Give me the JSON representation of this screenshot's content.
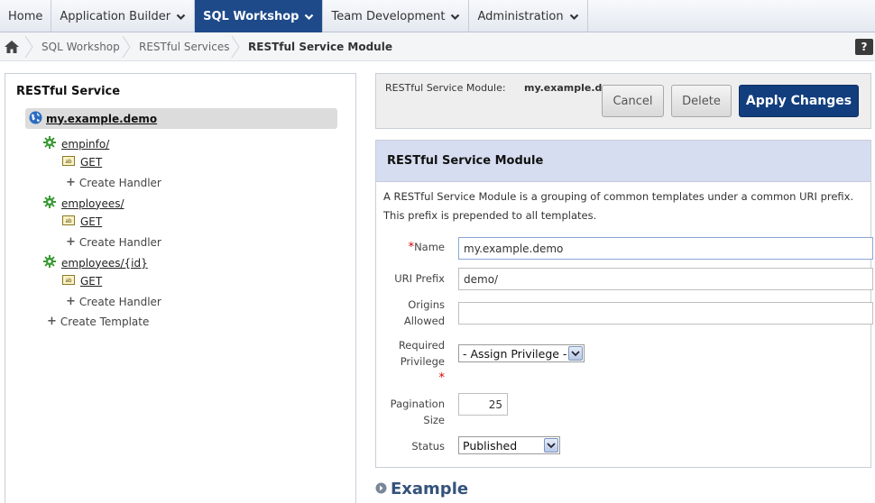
{
  "topnav": {
    "tabs": [
      {
        "label": "Home",
        "dropdown": false,
        "active": false
      },
      {
        "label": "Application Builder",
        "dropdown": true,
        "active": false
      },
      {
        "label": "SQL Workshop",
        "dropdown": true,
        "active": true
      },
      {
        "label": "Team Development",
        "dropdown": true,
        "active": false
      },
      {
        "label": "Administration",
        "dropdown": true,
        "active": false
      }
    ]
  },
  "breadcrumb": {
    "items": [
      "SQL Workshop",
      "RESTful Services",
      "RESTful Service Module"
    ]
  },
  "help": {
    "label": "?"
  },
  "tree": {
    "title": "RESTful Service",
    "root": "my.example.demo",
    "templates": [
      {
        "name": "empinfo/",
        "handler": "GET",
        "create_handler": "Create Handler"
      },
      {
        "name": "employees/",
        "handler": "GET",
        "create_handler": "Create Handler"
      },
      {
        "name": "employees/{id}",
        "handler": "GET",
        "create_handler": "Create Handler"
      }
    ],
    "create_template": "Create Template"
  },
  "actionbar": {
    "module_label": "RESTful Service Module:",
    "module_value": "my.example.demo",
    "cancel": "Cancel",
    "delete": "Delete",
    "apply": "Apply Changes"
  },
  "region": {
    "title": "RESTful Service Module",
    "description": "A RESTful Service Module is a grouping of common templates under a common URI prefix. This prefix is prepended to all templates.",
    "fields": {
      "name": {
        "label": "Name",
        "value": "my.example.demo"
      },
      "uri_prefix": {
        "label": "URI Prefix",
        "value": "demo/"
      },
      "origins": {
        "label_1": "Origins",
        "label_2": "Allowed",
        "value": ""
      },
      "privilege": {
        "label_1": "Required",
        "label_2": "Privilege",
        "value": "- Assign Privilege -"
      },
      "pagination": {
        "label_1": "Pagination",
        "label_2": "Size",
        "value": "25"
      },
      "status": {
        "label": "Status",
        "value": "Published"
      }
    },
    "required_marker": "*"
  },
  "example": {
    "title": "Example"
  },
  "colors": {
    "nav_active": "#1e4a8a",
    "primary_button": "#123e7e",
    "region_header": "#d6ddf0",
    "required": "#d40000"
  }
}
